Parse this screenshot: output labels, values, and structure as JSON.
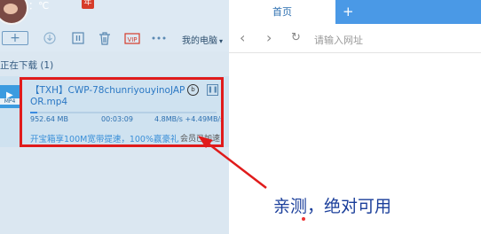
{
  "user": {
    "name": "：℃"
  },
  "toolbar": {
    "add": "+",
    "my_downloads": "我的电脑",
    "icons": [
      "add-icon",
      "download-icon",
      "pause-icon",
      "delete-icon",
      "vip-icon",
      "more-icon"
    ]
  },
  "downloads": {
    "section_title": "正在下载 (1)",
    "task": {
      "file_ext": "MP4",
      "title": "【TXH】CWP-78chunriyouyinoJAPOR.mp4",
      "size": "952.64 MB",
      "time_left": "00:03:09",
      "speed": "4.8MB/s +4.49MB/s",
      "progress": 0.04,
      "promo": "开宝箱享100M宽带提速，100%赢豪礼",
      "member_status": "会员已加速"
    }
  },
  "browser": {
    "tab_label": "首页",
    "new_tab": "+",
    "address_placeholder": "请输入网址"
  },
  "annotation": {
    "text": "亲测，绝对可用",
    "color": "#1a3e9a"
  },
  "colors": {
    "accent": "#4a99e6",
    "highlight": "#e01b1b"
  }
}
